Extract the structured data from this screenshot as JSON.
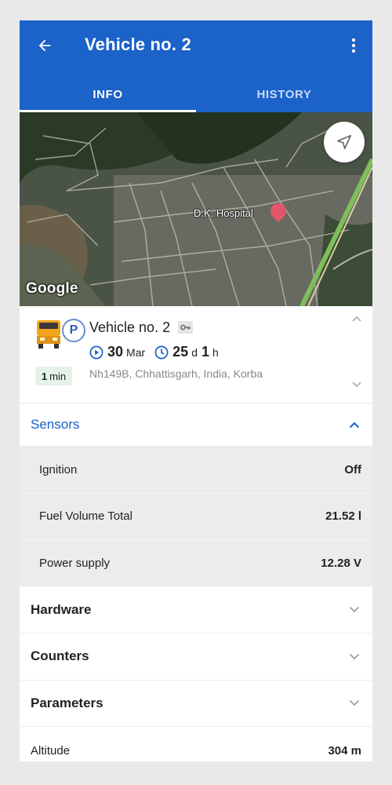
{
  "header": {
    "title": "Vehicle no. 2",
    "back_icon": "arrow-left-icon",
    "more_icon": "more-vert-icon",
    "bg_color": "#1b62c9"
  },
  "tabs": [
    {
      "label": "INFO",
      "active": true
    },
    {
      "label": "HISTORY",
      "active": false
    }
  ],
  "map": {
    "provider_label": "Google",
    "place_label": "D.K. Hospital",
    "locate_icon": "navigation-arrow-icon"
  },
  "vehicle": {
    "name": "Vehicle no. 2",
    "status_badge": "P",
    "last_update_value": "1",
    "last_update_unit": "min",
    "date_day": "30",
    "date_month": "Mar",
    "duration_days": "25",
    "duration_days_unit": "d",
    "duration_hours": "1",
    "duration_hours_unit": "h",
    "address": "Nh149B, Chhattisgarh, India, Korba"
  },
  "sensors": {
    "title": "Sensors",
    "items": [
      {
        "label": "Ignition",
        "value": "Off"
      },
      {
        "label": "Fuel Volume Total",
        "value": "21.52 l"
      },
      {
        "label": "Power supply",
        "value": "12.28 V"
      }
    ]
  },
  "sections": [
    {
      "label": "Hardware"
    },
    {
      "label": "Counters"
    },
    {
      "label": "Parameters"
    }
  ],
  "altitude": {
    "label": "Altitude",
    "value": "304 m"
  }
}
